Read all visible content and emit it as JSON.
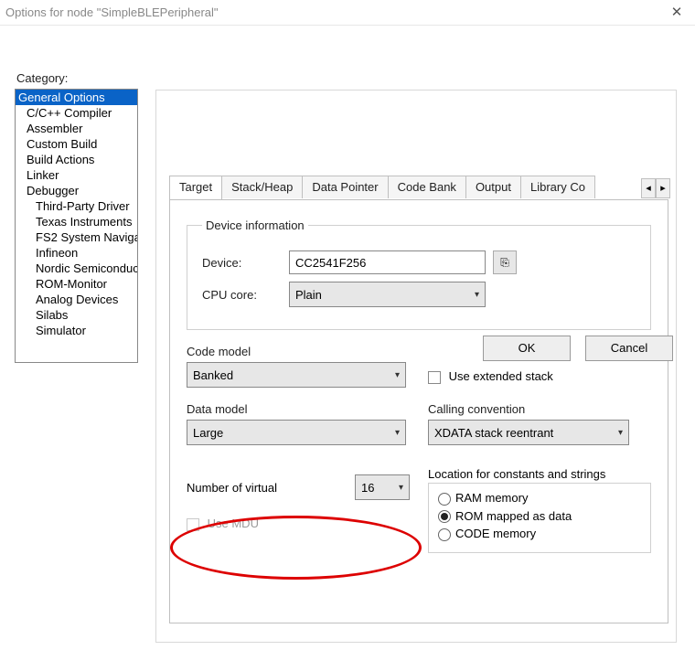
{
  "title": "Options for node \"SimpleBLEPeripheral\"",
  "categoryLabel": "Category:",
  "categories": [
    "General Options",
    "C/C++ Compiler",
    "Assembler",
    "Custom Build",
    "Build Actions",
    "Linker",
    "Debugger",
    "Third-Party Driver",
    "Texas Instruments",
    "FS2 System Naviga",
    "Infineon",
    "Nordic Semiconduc",
    "ROM-Monitor",
    "Analog Devices",
    "Silabs",
    "Simulator"
  ],
  "tabs": [
    "Target",
    "Stack/Heap",
    "Data Pointer",
    "Code Bank",
    "Output",
    "Library Co"
  ],
  "deviceInfo": {
    "legend": "Device information",
    "deviceLabel": "Device:",
    "deviceValue": "CC2541F256",
    "cpuLabel": "CPU core:",
    "cpuValue": "Plain"
  },
  "codeModel": {
    "label": "Code model",
    "value": "Banked"
  },
  "extStack": "Use extended stack",
  "dataModel": {
    "label": "Data model",
    "value": "Large"
  },
  "callingConv": {
    "label": "Calling convention",
    "value": "XDATA stack reentrant"
  },
  "numVirtual": {
    "label": "Number of virtual",
    "value": "16"
  },
  "useMDU": "Use MDU",
  "location": {
    "label": "Location for constants and strings",
    "opts": [
      "RAM memory",
      "ROM mapped as data",
      "CODE memory"
    ]
  },
  "buttons": {
    "ok": "OK",
    "cancel": "Cancel"
  }
}
